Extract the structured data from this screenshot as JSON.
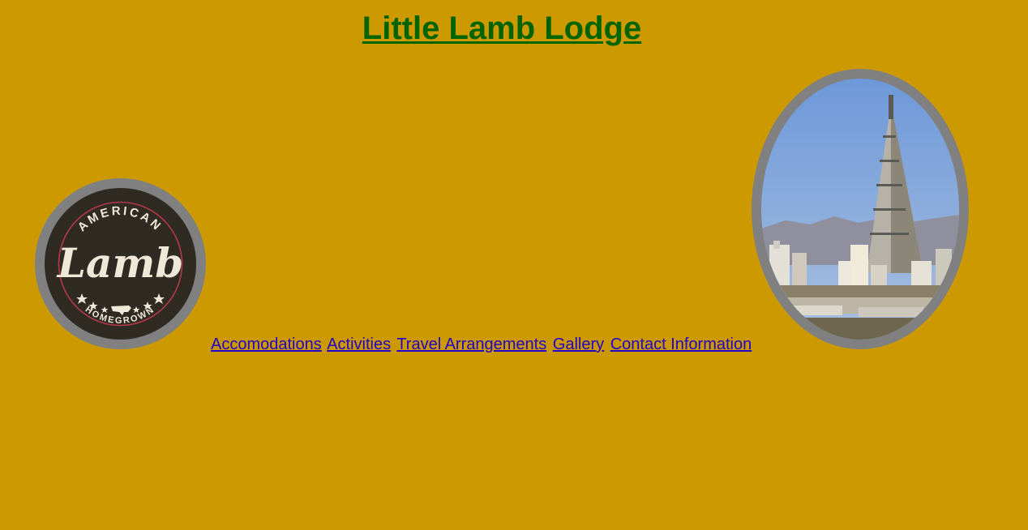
{
  "page": {
    "title": "Little Lamb Lodge",
    "background_color": "#cc9900",
    "title_color": "#006400",
    "link_color": "#2200cc"
  },
  "logo": {
    "alt": "American Lamb Homegrown logo",
    "arc_top": "AMERICAN",
    "script": "Lamb",
    "arc_bottom": "HOMEGROWN",
    "icon": "us-map-icon"
  },
  "photo": {
    "alt": "City skyline with tall pyramid tower"
  },
  "nav": {
    "items": [
      {
        "label": "Accomodations"
      },
      {
        "label": "Activities"
      },
      {
        "label": "Travel Arrangements"
      },
      {
        "label": "Gallery"
      },
      {
        "label": "Contact Information"
      }
    ]
  }
}
